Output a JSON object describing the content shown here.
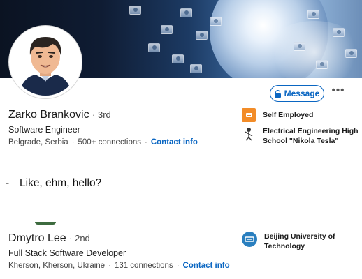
{
  "profile1": {
    "name": "Zarko Brankovic",
    "degree": "· 3rd",
    "headline": "Software Engineer",
    "location": "Belgrade, Serbia",
    "connections": "500+ connections",
    "separator": "·",
    "contact_label": "Contact info",
    "message_label": "Message",
    "more_label": "•••",
    "orgs": [
      {
        "name": "Self Employed",
        "logo": "briefcase-icon",
        "color": "#f28c28"
      },
      {
        "name_line1": "Electrical Engineering High",
        "name_line2": "School \"Nikola Tesla\"",
        "logo": "school-crest-icon"
      }
    ]
  },
  "quote": {
    "dash": "-",
    "text": "Like, ehm, hello?"
  },
  "profile2": {
    "name": "Dmytro Lee",
    "degree": "· 2nd",
    "headline": "Full Stack Software Developer",
    "location": "Kherson, Kherson, Ukraine",
    "connections": "131 connections",
    "separator": "·",
    "contact_label": "Contact info",
    "orgs": [
      {
        "name_line1": "Beijing University of",
        "name_line2": "Technology",
        "logo": "university-seal-icon",
        "color": "#2a7fbf"
      }
    ]
  },
  "colors": {
    "accent": "#0a66c2",
    "banner": "#0f1c33"
  }
}
